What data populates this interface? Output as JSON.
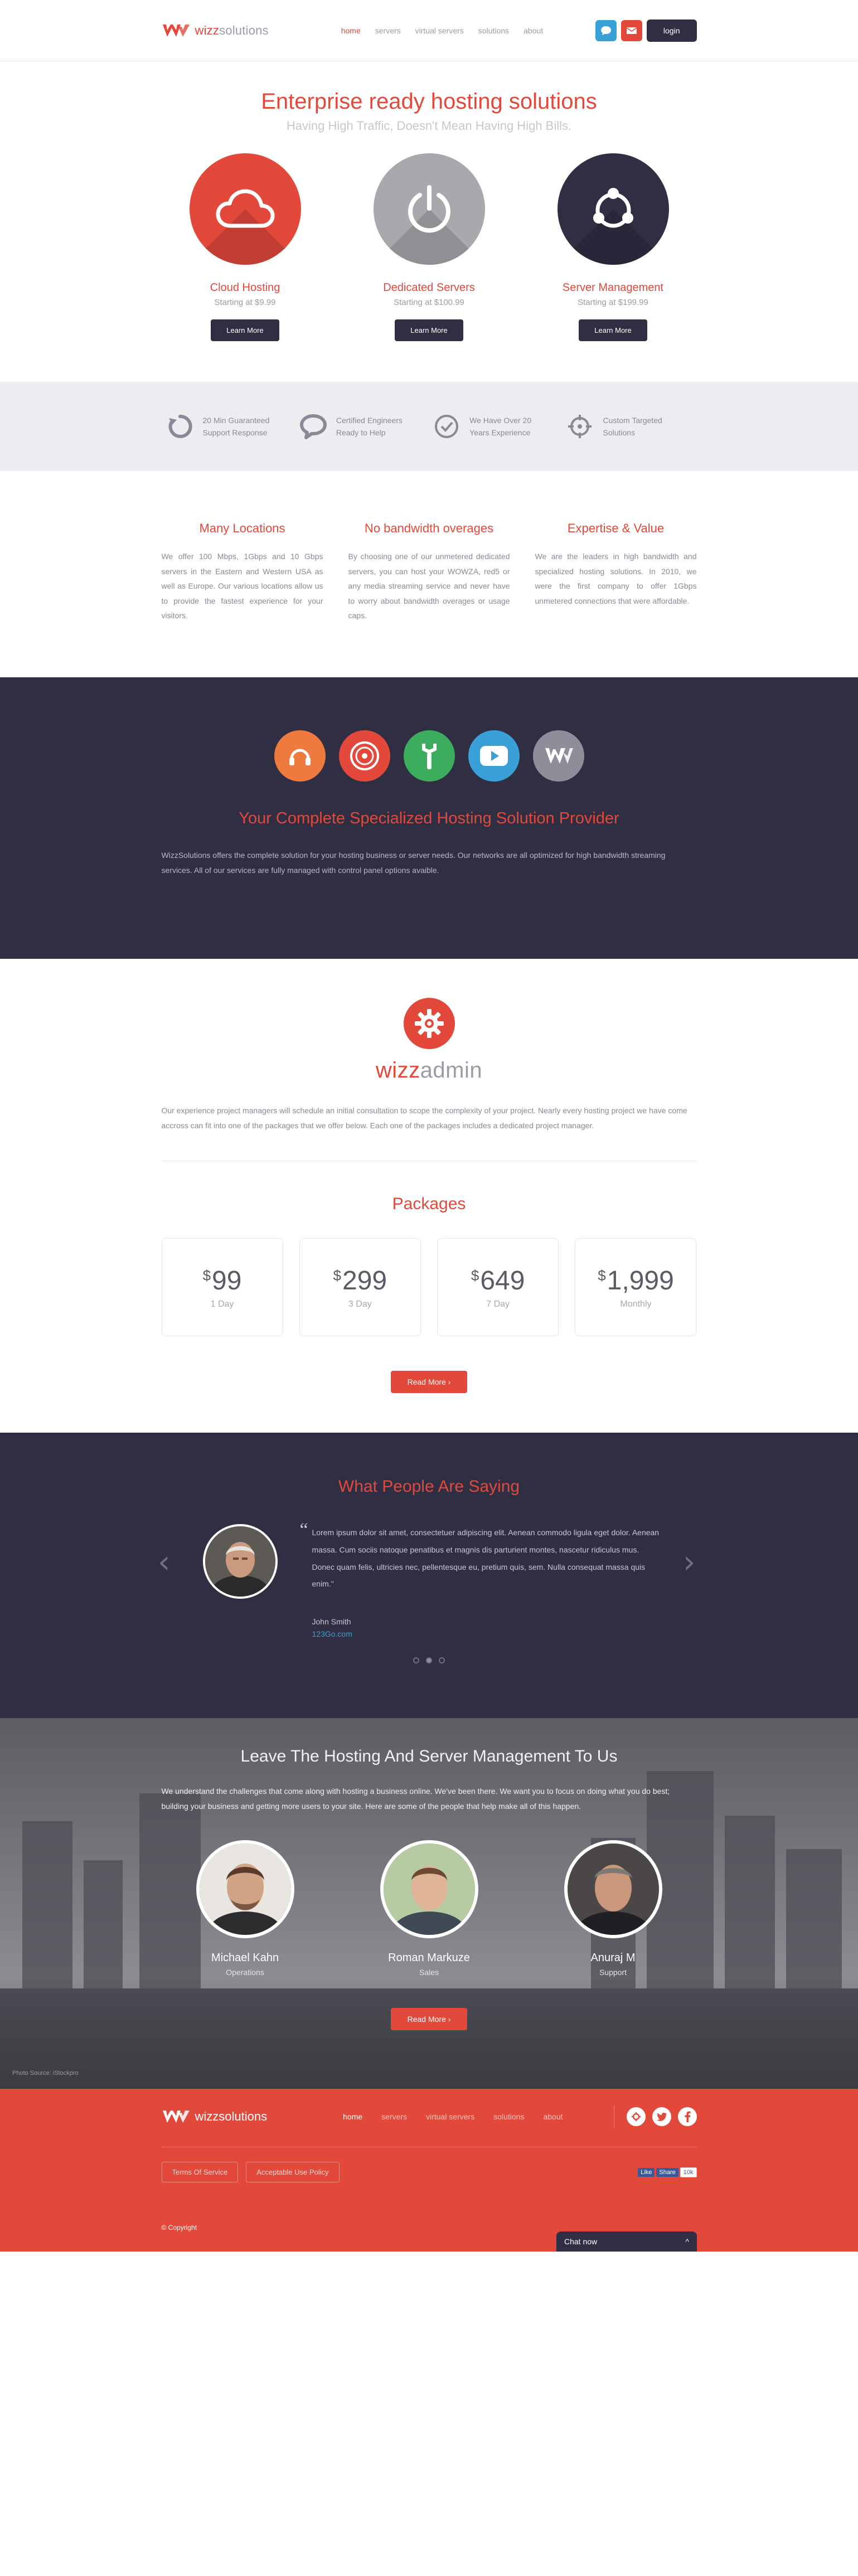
{
  "header": {
    "logo_prefix": "wizz",
    "logo_suffix": "solutions",
    "nav": [
      "home",
      "servers",
      "virtual servers",
      "solutions",
      "about"
    ],
    "login_label": "login"
  },
  "hero": {
    "title": "Enterprise ready hosting solutions",
    "subtitle": "Having High Traffic, Doesn't Mean Having High Bills.",
    "cards": [
      {
        "title": "Cloud Hosting",
        "price": "Starting at $9.99",
        "button": "Learn More",
        "icon": "cloud-icon",
        "color": "#e2493b"
      },
      {
        "title": "Dedicated Servers",
        "price": "Starting at $100.99",
        "button": "Learn More",
        "icon": "power-icon",
        "color": "#a8a8ad"
      },
      {
        "title": "Server Management",
        "price": "Starting at $199.99",
        "button": "Learn More",
        "icon": "network-icon",
        "color": "#2f2e43"
      }
    ]
  },
  "features": [
    {
      "line1": "20 Min Guaranteed",
      "line2": "Support Response",
      "icon": "refresh-icon"
    },
    {
      "line1": "Certified Engineers",
      "line2": "Ready to Help",
      "icon": "chat-bubble-icon"
    },
    {
      "line1": "We Have Over 20",
      "line2": "Years Experience",
      "icon": "check-circle-icon"
    },
    {
      "line1": "Custom Targeted",
      "line2": "Solutions",
      "icon": "target-icon"
    }
  ],
  "columns": [
    {
      "title": "Many Locations",
      "text": "We offer 100 Mbps, 1Gbps and 10 Gbps servers in the Eastern and Western USA as well as Europe. Our various locations allow us to provide the fastest experience for your visitors."
    },
    {
      "title": "No bandwidth overages",
      "text": "By choosing one of our unmetered dedicated servers, you can host your WOWZA, red5 or any media streaming service and never have to worry about bandwidth overages or usage caps."
    },
    {
      "title": "Expertise & Value",
      "text": "We are the leaders in high bandwidth and specialized hosting solutions. In 2010, we were the first company to offer 1Gbps unmetered connections that were affordable."
    }
  ],
  "provider": {
    "icons": [
      {
        "name": "headset-icon",
        "color": "#ee7a3f"
      },
      {
        "name": "vinyl-icon",
        "color": "#e2493b"
      },
      {
        "name": "wrench-icon",
        "color": "#3bad5c"
      },
      {
        "name": "youtube-icon",
        "color": "#3aa0d8"
      },
      {
        "name": "w-logo-icon",
        "color": "#8e8d99"
      }
    ],
    "title": "Your Complete Specialized Hosting Solution Provider",
    "text": "WizzSolutions offers the complete solution for your hosting business or server needs. Our networks are all optimized for high bandwidth streaming services. All of our services are fully managed with control panel options avaible."
  },
  "admin": {
    "title_prefix": "wizz",
    "title_suffix": "admin",
    "text": "Our experience project managers will schedule an initial consultation to scope the complexity of your project. Nearly every hosting project we have come accross can fit into one of the packages that we offer below. Each one of the packages includes a dedicated project manager.",
    "packages_title": "Packages",
    "packages": [
      {
        "currency": "$",
        "amount": "99",
        "period": "1 Day"
      },
      {
        "currency": "$",
        "amount": "299",
        "period": "3 Day"
      },
      {
        "currency": "$",
        "amount": "649",
        "period": "7 Day"
      },
      {
        "currency": "$",
        "amount": "1,999",
        "period": "Monthly"
      }
    ],
    "read_more": "Read More  ›"
  },
  "testimonial": {
    "title": "What People Are Saying",
    "quote": "Lorem ipsum dolor sit amet, consectetuer adipiscing elit. Aenean commodo ligula eget dolor. Aenean massa. Cum sociis natoque penatibus et magnis dis parturient montes, nascetur ridiculus mus. Donec quam felis, ultricies nec, pellentesque eu, pretium quis, sem. Nulla consequat massa quis enim.\"",
    "author": "John Smith",
    "site": "123Go.com",
    "active_dot": 1,
    "dot_count": 3
  },
  "team": {
    "title": "Leave The Hosting And Server Management To Us",
    "text": "We understand the challenges that come along with hosting a business online. We've been there. We want you to focus on doing what you do best; building your business and getting more users to your site. Here are some of the people that help make all of this happen.",
    "members": [
      {
        "name": "Michael Kahn",
        "role": "Operations"
      },
      {
        "name": "Roman Markuze",
        "role": "Sales"
      },
      {
        "name": "Anuraj M",
        "role": "Support"
      }
    ],
    "read_more": "Read More  ›",
    "credit": "Photo Source: iStockpro"
  },
  "footer": {
    "logo_prefix": "wizz",
    "logo_suffix": "solutions",
    "nav": [
      "home",
      "servers",
      "virtual servers",
      "solutions",
      "about"
    ],
    "links": [
      "Terms Of Service",
      "Acceptable Use Policy"
    ],
    "fb_like": "Like",
    "fb_share": "Share",
    "fb_count": "10k",
    "copyright": "© Copyright",
    "chat_label": "Chat now",
    "chat_toggle": "^"
  }
}
